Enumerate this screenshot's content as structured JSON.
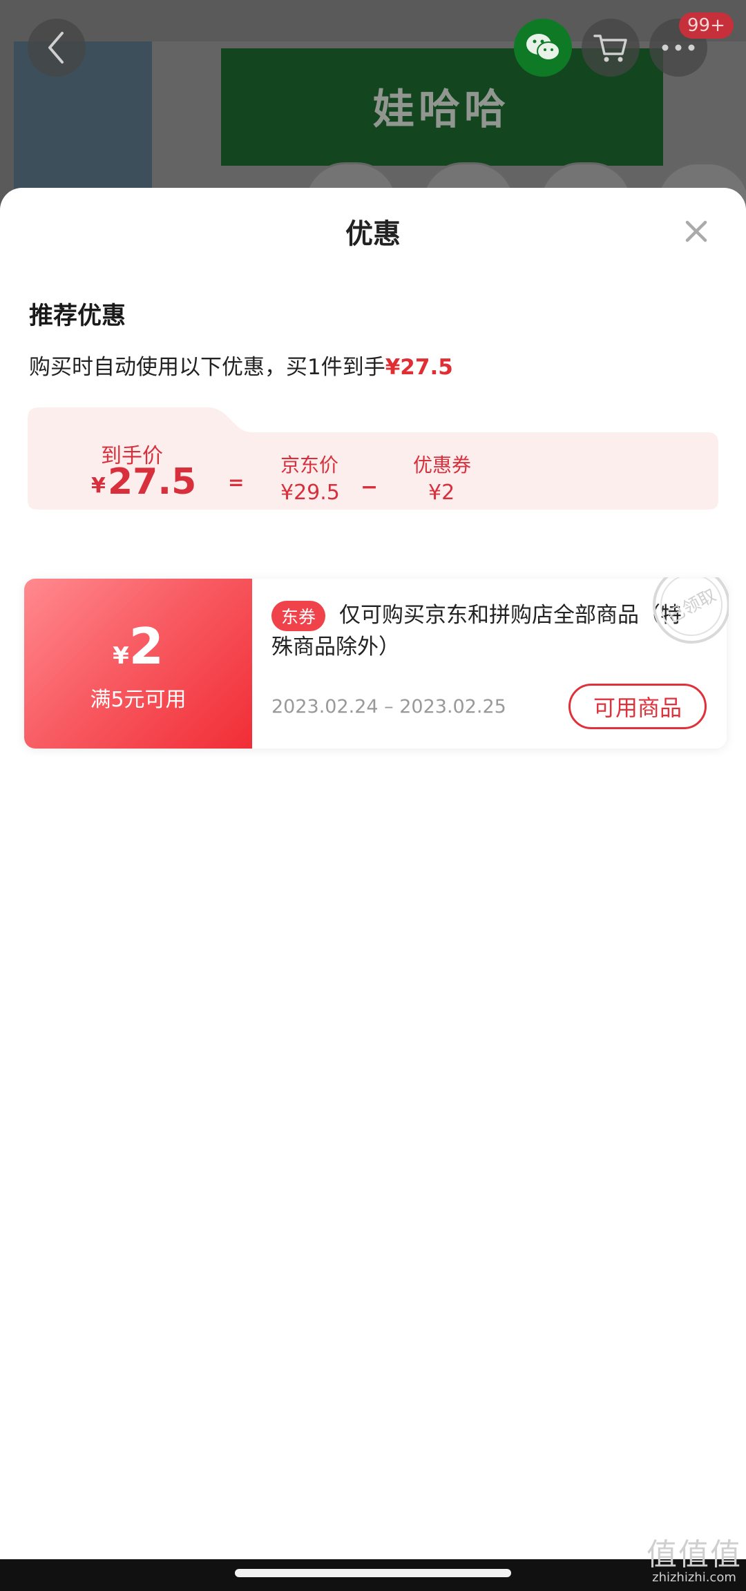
{
  "product_image": {
    "brand_text": "娃哈哈"
  },
  "top_nav": {
    "cart_badge": "99+"
  },
  "sheet": {
    "title": "优惠",
    "recommend": {
      "title": "推荐优惠",
      "desc_prefix": "购买时自动使用以下优惠，买1件到手",
      "desc_price": "¥27.5"
    },
    "price_breakdown": {
      "final_label": "到手价",
      "final_yen": "¥",
      "final_value": "27.5",
      "equals": "=",
      "jd_label": "京东价",
      "jd_value": "¥29.5",
      "minus": "−",
      "coupon_label": "优惠券",
      "coupon_value": "¥2"
    },
    "coupon": {
      "yen": "¥",
      "amount": "2",
      "condition": "满5元可用",
      "tag": "东券",
      "description": "仅可购买京东和拼购店全部商品（特殊商品除外）",
      "date_range": "2023.02.24 – 2023.02.25",
      "button_label": "可用商品",
      "stamp_text": "已领取"
    }
  },
  "watermark": {
    "glyphs": "值值值",
    "site": "zhizhizhi.com"
  },
  "colors": {
    "accent_red": "#e02f34",
    "card_pink": "#fdeeee"
  }
}
